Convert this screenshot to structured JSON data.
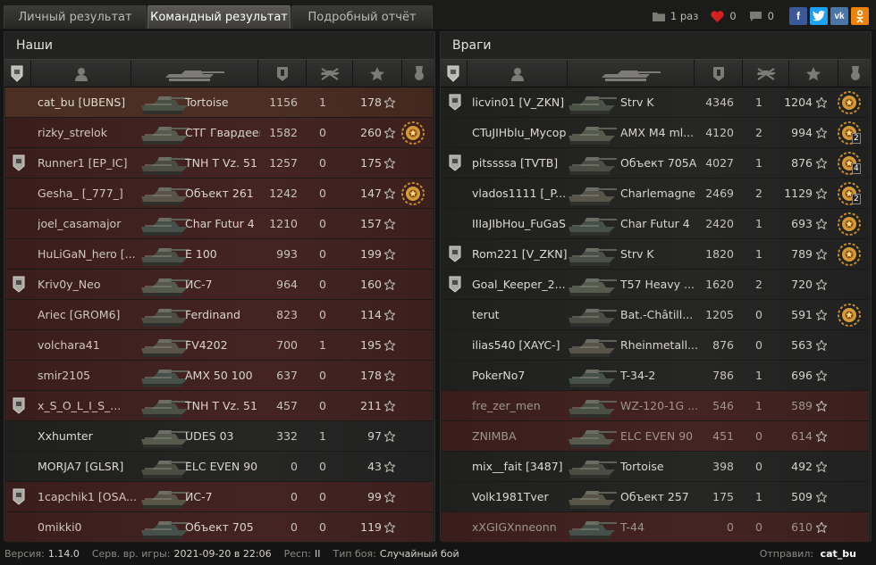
{
  "tabs": [
    {
      "label": "Личный результат"
    },
    {
      "label": "Командный результат"
    },
    {
      "label": "Подробный отчёт"
    }
  ],
  "share": {
    "views": "1 раз",
    "likes": "0",
    "comments": "0"
  },
  "social": [
    "f",
    "t",
    "vk",
    "ok"
  ],
  "left": {
    "title": "Наши",
    "rows": [
      {
        "name": "cat_bu [UBENS]",
        "tank": "Tortoise",
        "dmg": "1156",
        "kills": "1",
        "xp": "178",
        "style": "me",
        "clan": false,
        "medal": false,
        "mc": "",
        "dead": false
      },
      {
        "name": "rizky_strelok",
        "tank": "СТГ Гвардеец",
        "dmg": "1582",
        "kills": "0",
        "xp": "260",
        "style": "red",
        "clan": false,
        "medal": true,
        "mc": "",
        "dead": false
      },
      {
        "name": "Runner1 [EP_IC]",
        "tank": "TNH T Vz. 51",
        "dmg": "1257",
        "kills": "0",
        "xp": "175",
        "style": "red",
        "clan": true,
        "medal": false,
        "mc": "",
        "dead": false
      },
      {
        "name": "Gesha_ [_777_]",
        "tank": "Объект 261",
        "dmg": "1242",
        "kills": "0",
        "xp": "147",
        "style": "red",
        "clan": false,
        "medal": true,
        "mc": "",
        "dead": false
      },
      {
        "name": "joel_casamajor",
        "tank": "Char Futur 4",
        "dmg": "1210",
        "kills": "0",
        "xp": "157",
        "style": "red",
        "clan": false,
        "medal": false,
        "mc": "",
        "dead": false
      },
      {
        "name": "HuLiGaN_hero [...",
        "tank": "E 100",
        "dmg": "993",
        "kills": "0",
        "xp": "199",
        "style": "red",
        "clan": false,
        "medal": false,
        "mc": "",
        "dead": false
      },
      {
        "name": "Kriv0y_Neo",
        "tank": "ИС-7",
        "dmg": "964",
        "kills": "0",
        "xp": "160",
        "style": "red",
        "clan": true,
        "medal": false,
        "mc": "",
        "dead": false
      },
      {
        "name": "Ariec [GROM6]",
        "tank": "Ferdinand",
        "dmg": "823",
        "kills": "0",
        "xp": "114",
        "style": "red",
        "clan": false,
        "medal": false,
        "mc": "",
        "dead": false
      },
      {
        "name": "volchara41",
        "tank": "FV4202",
        "dmg": "700",
        "kills": "1",
        "xp": "195",
        "style": "red",
        "clan": false,
        "medal": false,
        "mc": "",
        "dead": false
      },
      {
        "name": "smir2105",
        "tank": "AMX 50 100",
        "dmg": "637",
        "kills": "0",
        "xp": "178",
        "style": "red",
        "clan": false,
        "medal": false,
        "mc": "",
        "dead": false
      },
      {
        "name": "x_S_O_L_I_S_...",
        "tank": "TNH T Vz. 51",
        "dmg": "457",
        "kills": "0",
        "xp": "211",
        "style": "red",
        "clan": true,
        "medal": false,
        "mc": "",
        "dead": false
      },
      {
        "name": "Xxhumter",
        "tank": "UDES 03",
        "dmg": "332",
        "kills": "1",
        "xp": "97",
        "style": "dark",
        "clan": false,
        "medal": false,
        "mc": "",
        "dead": false
      },
      {
        "name": "MORJA7 [GLSR]",
        "tank": "ELC EVEN 90",
        "dmg": "0",
        "kills": "0",
        "xp": "43",
        "style": "dark",
        "clan": false,
        "medal": false,
        "mc": "",
        "dead": false
      },
      {
        "name": "1capchik1 [OSA...",
        "tank": "ИС-7",
        "dmg": "0",
        "kills": "0",
        "xp": "99",
        "style": "red",
        "clan": true,
        "medal": false,
        "mc": "",
        "dead": false
      },
      {
        "name": "0mikki0",
        "tank": "Объект 705",
        "dmg": "0",
        "kills": "0",
        "xp": "119",
        "style": "red",
        "clan": false,
        "medal": false,
        "mc": "",
        "dead": false
      }
    ]
  },
  "right": {
    "title": "Враги",
    "rows": [
      {
        "name": "licvin01 [V_ZKN]",
        "tank": "Strv K",
        "dmg": "4346",
        "kills": "1",
        "xp": "1204",
        "style": "dark",
        "clan": true,
        "medal": true,
        "mc": "",
        "dead": false
      },
      {
        "name": "CTuJIHblu_Mycop",
        "tank": "AMX M4 ml...",
        "dmg": "4120",
        "kills": "2",
        "xp": "994",
        "style": "dark",
        "clan": false,
        "medal": true,
        "mc": "2",
        "dead": false
      },
      {
        "name": "pitssssa [TVTB]",
        "tank": "Объект 705A",
        "dmg": "4027",
        "kills": "1",
        "xp": "876",
        "style": "dark",
        "clan": true,
        "medal": true,
        "mc": "4",
        "dead": false
      },
      {
        "name": "vlados1111 [_P...",
        "tank": "Charlemagne",
        "dmg": "2469",
        "kills": "2",
        "xp": "1129",
        "style": "dark",
        "clan": false,
        "medal": true,
        "mc": "2",
        "dead": false
      },
      {
        "name": "IIIaJIbHou_FuGaS",
        "tank": "Char Futur 4",
        "dmg": "2420",
        "kills": "1",
        "xp": "693",
        "style": "dark",
        "clan": false,
        "medal": true,
        "mc": "",
        "dead": false
      },
      {
        "name": "Rom221 [V_ZKN]",
        "tank": "Strv K",
        "dmg": "1820",
        "kills": "1",
        "xp": "789",
        "style": "dark",
        "clan": true,
        "medal": true,
        "mc": "",
        "dead": false
      },
      {
        "name": "Goal_Keeper_2...",
        "tank": "T57 Heavy ...",
        "dmg": "1620",
        "kills": "2",
        "xp": "720",
        "style": "dark",
        "clan": true,
        "medal": false,
        "mc": "",
        "dead": false
      },
      {
        "name": "terut",
        "tank": "Bat.-Châtill...",
        "dmg": "1205",
        "kills": "0",
        "xp": "591",
        "style": "dark",
        "clan": false,
        "medal": true,
        "mc": "",
        "dead": false
      },
      {
        "name": "ilias540 [XAYC-]",
        "tank": "Rheinmetall...",
        "dmg": "876",
        "kills": "0",
        "xp": "563",
        "style": "dark",
        "clan": false,
        "medal": false,
        "mc": "",
        "dead": false
      },
      {
        "name": "PokerNo7",
        "tank": "T-34-2",
        "dmg": "786",
        "kills": "1",
        "xp": "696",
        "style": "dark",
        "clan": false,
        "medal": false,
        "mc": "",
        "dead": false
      },
      {
        "name": "fre_zer_men",
        "tank": "WZ-120-1G ...",
        "dmg": "546",
        "kills": "1",
        "xp": "589",
        "style": "red",
        "clan": false,
        "medal": false,
        "mc": "",
        "dead": true
      },
      {
        "name": "ZNIMBA",
        "tank": "ELC EVEN 90",
        "dmg": "451",
        "kills": "0",
        "xp": "614",
        "style": "red",
        "clan": false,
        "medal": false,
        "mc": "",
        "dead": true
      },
      {
        "name": "mix__fait [3487]",
        "tank": "Tortoise",
        "dmg": "398",
        "kills": "0",
        "xp": "492",
        "style": "dark",
        "clan": false,
        "medal": false,
        "mc": "",
        "dead": false
      },
      {
        "name": "Volk1981Tver",
        "tank": "Объект 257",
        "dmg": "175",
        "kills": "1",
        "xp": "509",
        "style": "dark",
        "clan": false,
        "medal": false,
        "mc": "",
        "dead": false
      },
      {
        "name": "xXGIGXnneonn",
        "tank": "T-44",
        "dmg": "0",
        "kills": "0",
        "xp": "610",
        "style": "red",
        "clan": false,
        "medal": false,
        "mc": "",
        "dead": true
      }
    ]
  },
  "footer": {
    "version_label": "Версия:",
    "version": "1.14.0",
    "server_label": "Серв. вр. игры:",
    "server_time": "2021-09-20 в 22:06",
    "res_label": "Респ:",
    "res": "II",
    "type_label": "Тип боя:",
    "type": "Случайный бой",
    "sent_label": "Отправил:",
    "sent_by": "cat_bu"
  }
}
